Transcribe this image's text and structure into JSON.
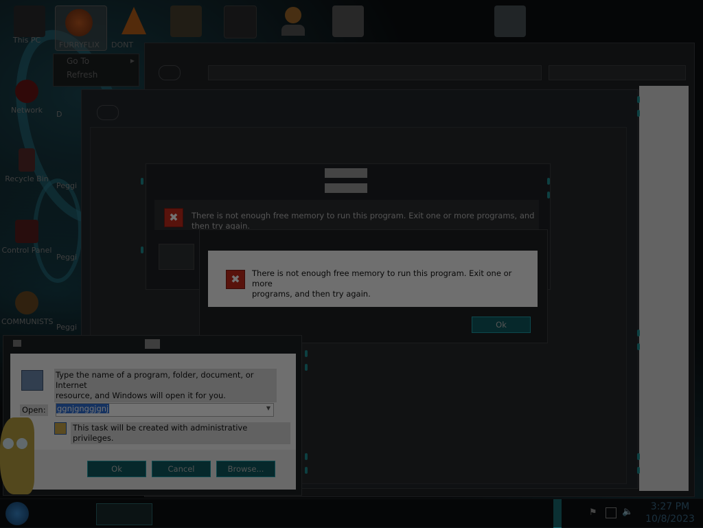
{
  "desktop": {
    "left_icons": [
      {
        "label": "This PC"
      },
      {
        "label": "Network"
      },
      {
        "label": "Recycle Bin"
      },
      {
        "label": "Control Panel"
      },
      {
        "label": "COMMUNISTS"
      }
    ],
    "second_column": [
      {
        "label": "D"
      },
      {
        "label": "Peggi"
      },
      {
        "label": "Peggi"
      },
      {
        "label": "Peggi"
      }
    ],
    "top_icons": [
      {
        "label": "FURRYFLIX",
        "selected": true
      },
      {
        "label": "DONT"
      }
    ]
  },
  "context_menu": {
    "items": [
      {
        "label": "Go To"
      },
      {
        "label": "Refresh"
      }
    ]
  },
  "error_back": {
    "message": "There is not enough free memory to run this program. Exit one or more programs, and then try again."
  },
  "error_front": {
    "message_line1": "There is not enough free memory to run this program. Exit one or more",
    "message_line2": "programs, and then try again.",
    "ok_label": "Ok"
  },
  "run_dialog": {
    "description_line1": "Type the name of a program, folder, document, or Internet",
    "description_line2": "resource, and Windows will open it for you.",
    "open_label": "Open:",
    "open_value": "ggnjgnggjgnj",
    "admin_note": "This task will be created with administrative privileges.",
    "ok_label": "Ok",
    "cancel_label": "Cancel",
    "browse_label": "Browse..."
  },
  "taskbar": {
    "time": "3:27 PM",
    "date": "10/8/2023"
  },
  "colors": {
    "accent": "#1fa3ad",
    "error": "#c42b1c"
  }
}
